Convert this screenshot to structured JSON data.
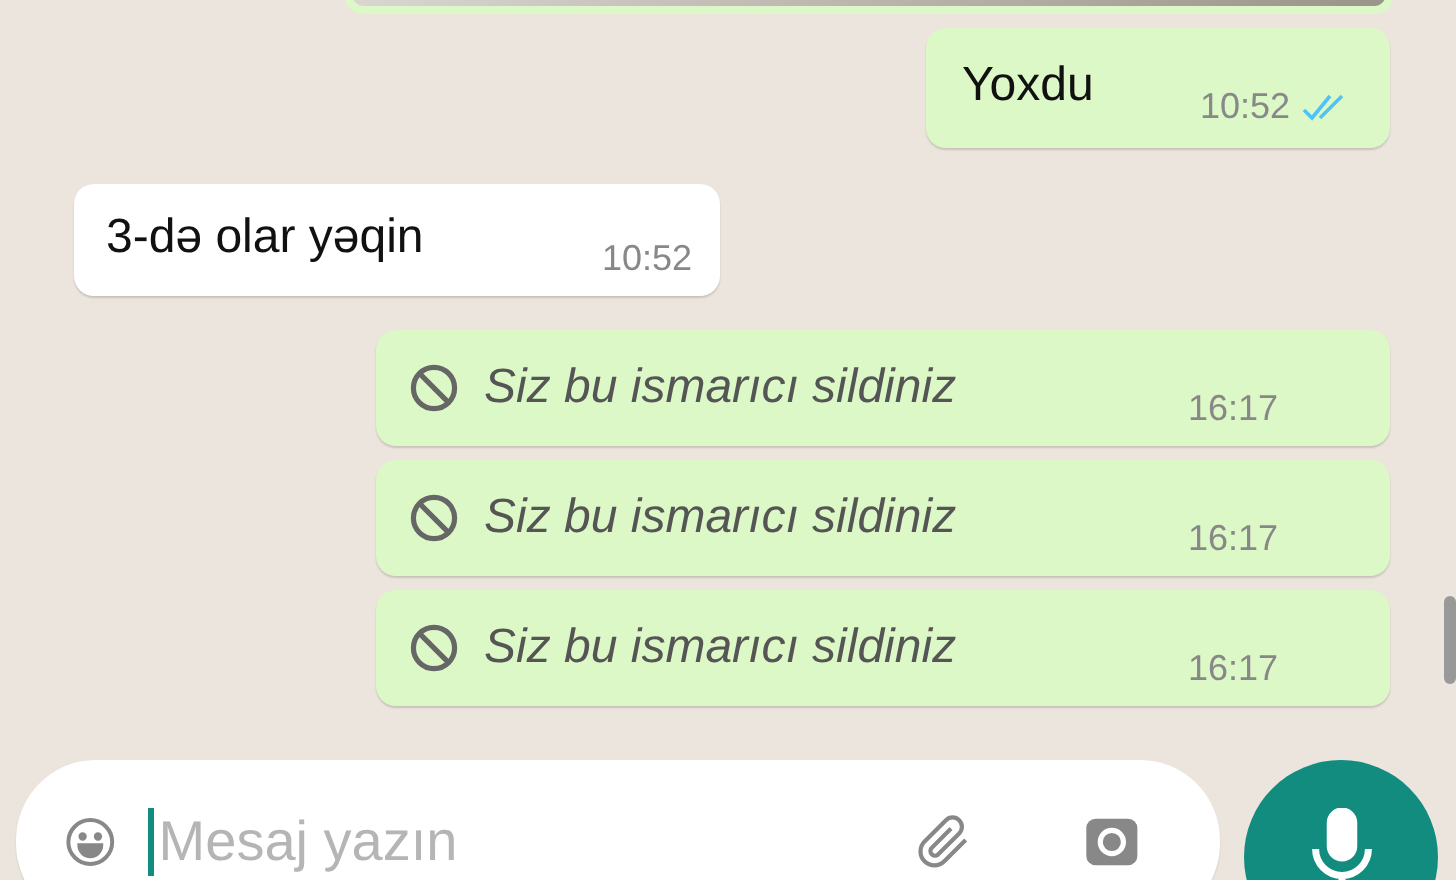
{
  "messages": [
    {
      "kind": "image",
      "outgoing": true
    },
    {
      "kind": "text",
      "outgoing": true,
      "text": "Yoxdu",
      "time": "10:52",
      "read": true
    },
    {
      "kind": "text",
      "outgoing": false,
      "text": "3-də olar yəqin",
      "time": "10:52"
    },
    {
      "kind": "deleted",
      "outgoing": true,
      "text": "Siz bu ismarıcı sildiniz",
      "time": "16:17"
    },
    {
      "kind": "deleted",
      "outgoing": true,
      "text": "Siz bu ismarıcı sildiniz",
      "time": "16:17"
    },
    {
      "kind": "deleted",
      "outgoing": true,
      "text": "Siz bu ismarıcı sildiniz",
      "time": "16:17"
    }
  ],
  "composer": {
    "placeholder": "Mesaj yazın"
  }
}
